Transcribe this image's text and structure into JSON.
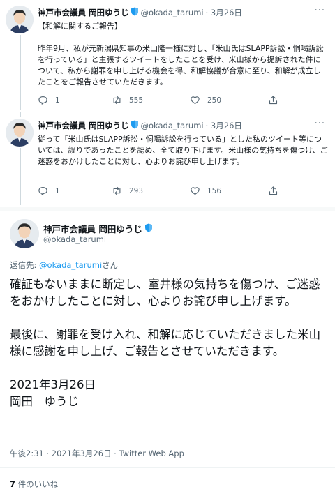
{
  "author": {
    "name": "神戸市会議員 岡田ゆうじ",
    "handle": "@okada_tarumi",
    "badge_color": "#1d9bf0"
  },
  "tweets": [
    {
      "date": "· 3月26日",
      "paragraphs": [
        "【和解に関するご報告】",
        "昨年9月、私が元新潟県知事の米山隆一様に対し、「米山氏はSLAPP訴訟・恫喝訴訟を行っている」と主張するツイートをしたことを受け、米山様から提訴された件について、私から謝罪を申し上げる機会を得、和解協議が合意に至り、和解が成立したことをご報告させていただきます。"
      ],
      "replies": "1",
      "retweets": "555",
      "likes": "250"
    },
    {
      "date": "· 3月26日",
      "paragraphs": [
        "従って「米山氏はSLAPP訴訟・恫喝訴訟を行っている」とした私のツイート等については、誤りであったことを認め、全て取り下げます。米山様の気持ちを傷つけ、ご迷惑をおかけしたことに対し、心よりお詫び申し上げます。"
      ],
      "replies": "1",
      "retweets": "293",
      "likes": "156"
    }
  ],
  "main_tweet": {
    "reply_prefix": "返信先: ",
    "reply_handle": "@okada_tarumi",
    "reply_suffix": "さん",
    "paragraphs": [
      "確証もないままに断定し、室井様の気持ちを傷つけ、ご迷惑をおかけしたことに対し、心よりお詫び申し上げます。",
      "最後に、謝罪を受け入れ、和解に応じていただきました米山様に感謝を申し上げ、ご報告とさせていただきます。",
      "2021年3月26日\n岡田　ゆうじ"
    ],
    "timestamp": "午後2:31 · 2021年3月26日 · Twitter Web App",
    "likes_count": "7",
    "likes_label": " 件のいいね"
  },
  "icons": {
    "more": "more-icon",
    "reply": "reply-icon",
    "retweet": "retweet-icon",
    "like": "like-icon",
    "verified": "shield-badge-icon"
  }
}
